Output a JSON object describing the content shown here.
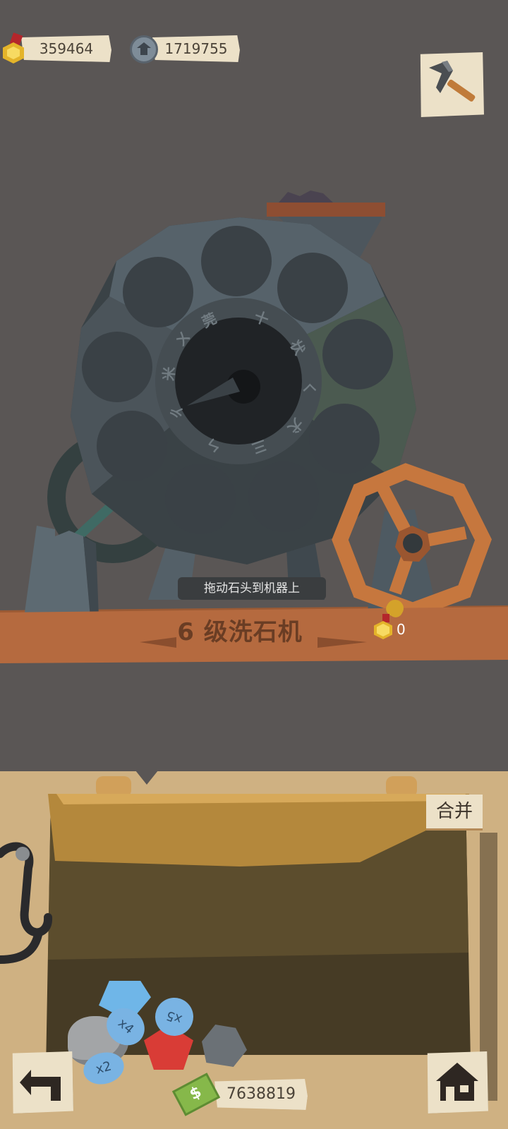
{
  "top_bar": {
    "medal_count": "359464",
    "gear_count": "1719755"
  },
  "machine": {
    "hint": "拖动石头到机器上",
    "title": "6 级洗石机",
    "reward_value": "0",
    "dial_symbols": [
      "莞",
      "十",
      "状",
      "ㄑ",
      "犬",
      "三",
      "ㄣ",
      "ㄔ",
      "米",
      "ㄨ"
    ]
  },
  "bag": {
    "merge_label": "合并",
    "money": "7638819",
    "stones": [
      {
        "name": "grey-stone",
        "multiplier": "x2"
      },
      {
        "name": "blue-crystal",
        "multiplier": "x4"
      },
      {
        "name": "red-ruby",
        "multiplier": "x5"
      }
    ]
  },
  "colors": {
    "background": "#5a5655",
    "wood": "#b56a3f",
    "machine_body": "#4b5359",
    "wheel": "#c6773e",
    "paper": "#ece1c8"
  },
  "icons": {
    "tool_button": "pickaxe-icon",
    "back_button": "back-arrow-icon",
    "home_button": "house-icon"
  }
}
